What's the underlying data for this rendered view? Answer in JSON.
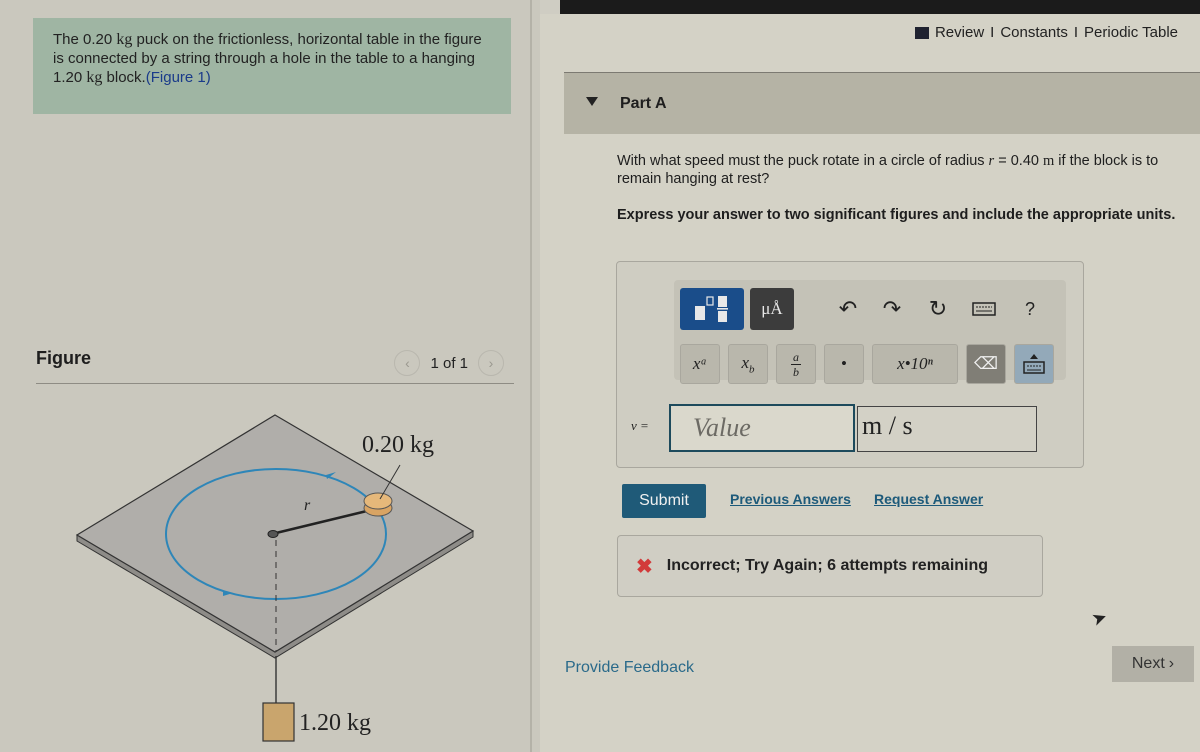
{
  "problem": {
    "intro_part1": "The 0.20 ",
    "intro_kg1": "kg",
    "intro_part2": " puck on the frictionless, horizontal table in the figure is connected by a string through a hole in the table to a hanging 1.20 ",
    "intro_kg2": "kg",
    "intro_part3": " block.",
    "figure_link": "(Figure 1)"
  },
  "header_links": {
    "review": "Review",
    "sep1": "I",
    "constants": "Constants",
    "sep2": "I",
    "periodic_table": "Periodic Table"
  },
  "figure": {
    "title": "Figure",
    "pager": "1 of 1",
    "prev_icon": "chevron-left-icon",
    "next_icon": "chevron-right-icon",
    "labels": {
      "puck_mass": "0.20 kg",
      "radius": "r",
      "block_mass": "1.20 kg"
    },
    "colors": {
      "table": "#b0aeaa",
      "orbit": "#2e86b8",
      "puck": "#e6b87a",
      "block": "#c9a56d"
    }
  },
  "part": {
    "title": "Part A",
    "question_pre": "With what speed must the puck rotate in a circle of radius ",
    "question_var": "r",
    "question_eq": " = 0.40 ",
    "question_unit": "m",
    "question_post": " if the block is to remain hanging at rest?",
    "instruction": "Express your answer to two significant figures and include the appropriate units."
  },
  "toolbar": {
    "templates_icon": "templates-icon",
    "units_label": "μÅ",
    "undo_icon": "undo-icon",
    "redo_icon": "redo-icon",
    "reset_icon": "reset-icon",
    "keyboard_icon": "keyboard-icon",
    "help_label": "?",
    "keys": {
      "superscript": "xᵃ",
      "subscript": "x_b",
      "fraction_top": "a",
      "fraction_bottom": "b",
      "dot": "•",
      "sci": "x•10ⁿ",
      "delete_label": "⌫"
    }
  },
  "answer": {
    "variable_label": "v =",
    "value_placeholder": "Value",
    "value": "",
    "units_value": "m / s"
  },
  "actions": {
    "submit": "Submit",
    "previous_answers": "Previous Answers",
    "request_answer": "Request Answer"
  },
  "feedback": {
    "icon": "✖",
    "message": "Incorrect; Try Again; 6 attempts remaining",
    "status_color": "#d23a3a"
  },
  "footer": {
    "provide_feedback": "Provide Feedback",
    "next": "Next",
    "next_chevron": "›"
  }
}
